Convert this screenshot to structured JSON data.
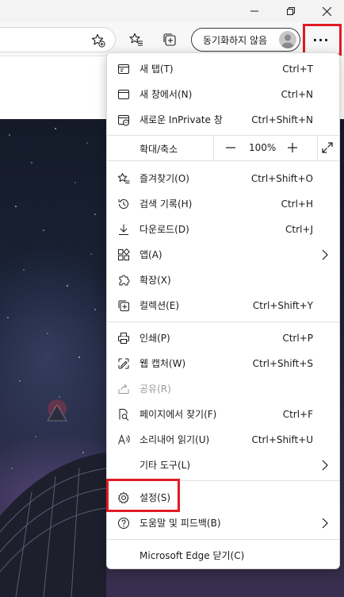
{
  "window": {
    "controls": [
      {
        "name": "minimize",
        "icon": "minimize-icon"
      },
      {
        "name": "restore",
        "icon": "restore-icon"
      },
      {
        "name": "close",
        "icon": "close-icon"
      }
    ]
  },
  "toolbar": {
    "sync_label": "동기화하지 않음",
    "more_label": "···"
  },
  "menu": {
    "new_tab": {
      "label": "새 탭(T)",
      "shortcut": "Ctrl+T"
    },
    "new_window": {
      "label": "새 창에서(N)",
      "shortcut": "Ctrl+N"
    },
    "new_inprivate": {
      "label": "새로운 InPrivate 창",
      "shortcut": "Ctrl+Shift+N"
    },
    "zoom": {
      "label": "확대/축소",
      "value": "100%"
    },
    "favorites": {
      "label": "즐겨찾기(O)",
      "shortcut": "Ctrl+Shift+O"
    },
    "history": {
      "label": "검색 기록(H)",
      "shortcut": "Ctrl+H"
    },
    "downloads": {
      "label": "다운로드(D)",
      "shortcut": "Ctrl+J"
    },
    "apps": {
      "label": "앱(A)"
    },
    "extensions": {
      "label": "확장(X)"
    },
    "collections": {
      "label": "컬렉션(E)",
      "shortcut": "Ctrl+Shift+Y"
    },
    "print": {
      "label": "인쇄(P)",
      "shortcut": "Ctrl+P"
    },
    "web_capture": {
      "label": "웹 캡처(W)",
      "shortcut": "Ctrl+Shift+S"
    },
    "share": {
      "label": "공유(R)"
    },
    "find": {
      "label": "페이지에서 찾기(F)",
      "shortcut": "Ctrl+F"
    },
    "read_aloud": {
      "label": "소리내어 읽기(U)",
      "shortcut": "Ctrl+Shift+U"
    },
    "more_tools": {
      "label": "기타 도구(L)"
    },
    "settings": {
      "label": "설정(S)"
    },
    "help": {
      "label": "도움말 및 피드백(B)"
    },
    "close_edge": {
      "label": "Microsoft Edge 닫기(C)"
    }
  },
  "colors": {
    "highlight": "#e01b24",
    "menu_bg": "#ffffff",
    "text": "#1b1b1b",
    "disabled": "#9a9a9a"
  }
}
